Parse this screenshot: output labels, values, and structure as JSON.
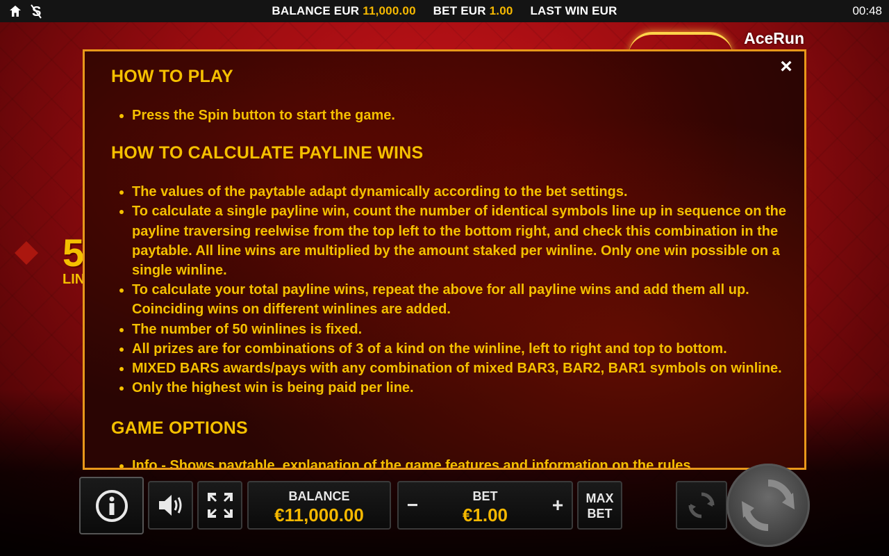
{
  "topbar": {
    "balance_label": "BALANCE EUR",
    "balance_value": "11,000.00",
    "bet_label": "BET EUR",
    "bet_value": "1.00",
    "lastwin_label": "LAST WIN EUR",
    "clock": "00:48",
    "icons": [
      "home-icon",
      "sweepstakes-icon"
    ]
  },
  "brand": {
    "logo_text": "AceRun"
  },
  "side_badge": {
    "number": "5",
    "label": "LIN"
  },
  "help": {
    "sections": [
      {
        "heading": "HOW TO PLAY",
        "items": [
          "Press the Spin button to start the game."
        ]
      },
      {
        "heading": "HOW TO CALCULATE PAYLINE WINS",
        "items": [
          "The values of the paytable adapt dynamically according to the bet settings.",
          "To calculate a single payline win, count the number of identical symbols line up in sequence on the payline traversing reelwise from the top left to the bottom right, and check this combination in the paytable. All line wins are multiplied by the amount staked per winline. Only one win possible on a single winline.",
          "To calculate your total payline wins, repeat the above for all payline wins and add them all up. Coinciding wins on different winlines are added.",
          "The number of 50 winlines is fixed.",
          "All prizes are for combinations of 3 of a kind on the winline, left to right and top to bottom.",
          "MIXED BARS awards/pays with any combination of mixed BAR3, BAR2, BAR1 symbols on winline.",
          "Only the highest win is being paid per line."
        ]
      },
      {
        "heading": "GAME OPTIONS",
        "items": [
          "Info - Shows paytable, explanation of the game features and information on the rules"
        ]
      }
    ]
  },
  "controls": {
    "balance_label": "BALANCE",
    "balance_value": "€11,000.00",
    "bet_label": "BET",
    "bet_value": "€1.00",
    "minus": "−",
    "plus": "+",
    "maxbet": "MAX BET"
  },
  "colors": {
    "accent": "#f5c000",
    "panel_border": "#e8981a",
    "background": "#b0101a"
  }
}
